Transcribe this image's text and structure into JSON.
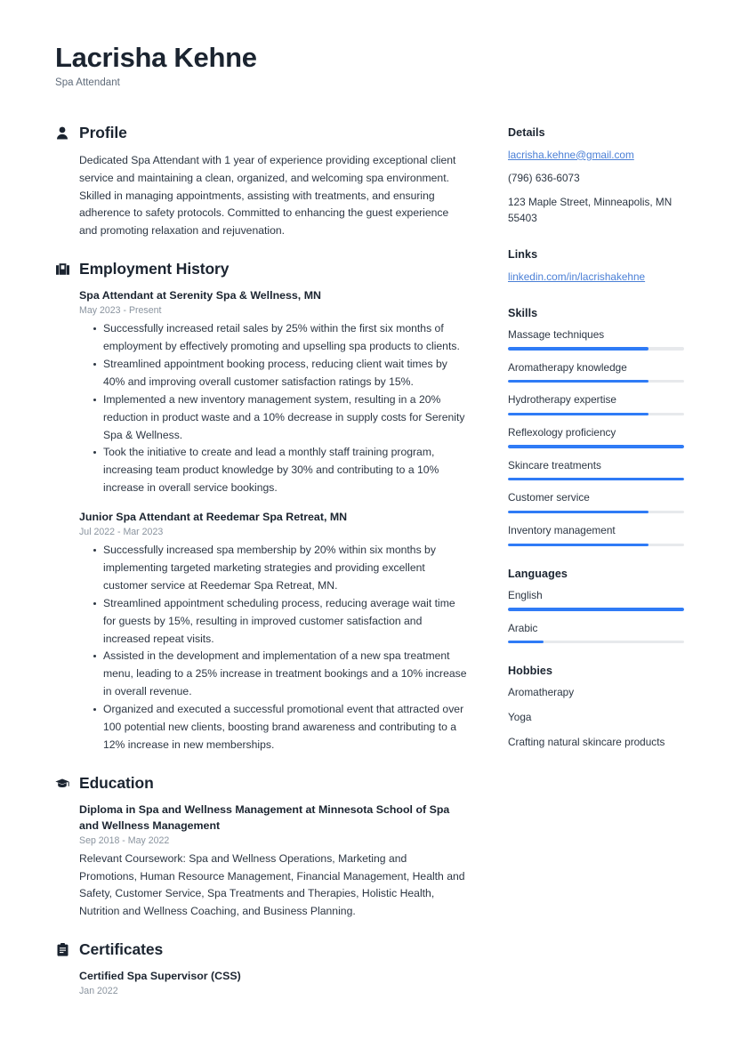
{
  "header": {
    "name": "Lacrisha Kehne",
    "job_title": "Spa Attendant"
  },
  "sections": {
    "profile": {
      "title": "Profile",
      "icon": "person-icon",
      "text": "Dedicated Spa Attendant with 1 year of experience providing exceptional client service and maintaining a clean, organized, and welcoming spa environment. Skilled in managing appointments, assisting with treatments, and ensuring adherence to safety protocols. Committed to enhancing the guest experience and promoting relaxation and rejuvenation."
    },
    "employment": {
      "title": "Employment History",
      "icon": "briefcase-icon",
      "entries": [
        {
          "title": "Spa Attendant at Serenity Spa & Wellness, MN",
          "date": "May 2023 - Present",
          "bullets": [
            "Successfully increased retail sales by 25% within the first six months of employment by effectively promoting and upselling spa products to clients.",
            "Streamlined appointment booking process, reducing client wait times by 40% and improving overall customer satisfaction ratings by 15%.",
            "Implemented a new inventory management system, resulting in a 20% reduction in product waste and a 10% decrease in supply costs for Serenity Spa & Wellness.",
            "Took the initiative to create and lead a monthly staff training program, increasing team product knowledge by 30% and contributing to a 10% increase in overall service bookings."
          ]
        },
        {
          "title": "Junior Spa Attendant at Reedemar Spa Retreat, MN",
          "date": "Jul 2022 - Mar 2023",
          "bullets": [
            "Successfully increased spa membership by 20% within six months by implementing targeted marketing strategies and providing excellent customer service at Reedemar Spa Retreat, MN.",
            "Streamlined appointment scheduling process, reducing average wait time for guests by 15%, resulting in improved customer satisfaction and increased repeat visits.",
            "Assisted in the development and implementation of a new spa treatment menu, leading to a 25% increase in treatment bookings and a 10% increase in overall revenue.",
            "Organized and executed a successful promotional event that attracted over 100 potential new clients, boosting brand awareness and contributing to a 12% increase in new memberships."
          ]
        }
      ]
    },
    "education": {
      "title": "Education",
      "icon": "graduation-cap-icon",
      "entries": [
        {
          "title": "Diploma in Spa and Wellness Management at Minnesota School of Spa and Wellness Management",
          "date": "Sep 2018 - May 2022",
          "description": "Relevant Coursework: Spa and Wellness Operations, Marketing and Promotions, Human Resource Management, Financial Management, Health and Safety, Customer Service, Spa Treatments and Therapies, Holistic Health, Nutrition and Wellness Coaching, and Business Planning."
        }
      ]
    },
    "certificates": {
      "title": "Certificates",
      "icon": "clipboard-icon",
      "entries": [
        {
          "title": "Certified Spa Supervisor (CSS)",
          "date": "Jan 2022"
        }
      ]
    }
  },
  "sidebar": {
    "details": {
      "title": "Details",
      "email": "lacrisha.kehne@gmail.com",
      "phone": "(796) 636-6073",
      "address": "123 Maple Street, Minneapolis, MN 55403"
    },
    "links": {
      "title": "Links",
      "items": [
        {
          "label": "linkedin.com/in/lacrishakehne"
        }
      ]
    },
    "skills": {
      "title": "Skills",
      "items": [
        {
          "label": "Massage techniques",
          "level": 80
        },
        {
          "label": "Aromatherapy knowledge",
          "level": 80
        },
        {
          "label": "Hydrotherapy expertise",
          "level": 80
        },
        {
          "label": "Reflexology proficiency",
          "level": 100
        },
        {
          "label": "Skincare treatments",
          "level": 100
        },
        {
          "label": "Customer service",
          "level": 80
        },
        {
          "label": "Inventory management",
          "level": 80
        }
      ]
    },
    "languages": {
      "title": "Languages",
      "items": [
        {
          "label": "English",
          "level": 100
        },
        {
          "label": "Arabic",
          "level": 20
        }
      ]
    },
    "hobbies": {
      "title": "Hobbies",
      "items": [
        {
          "label": "Aromatherapy"
        },
        {
          "label": "Yoga"
        },
        {
          "label": "Crafting natural skincare products"
        }
      ]
    }
  },
  "theme": {
    "accent": "#2f7bf6",
    "link": "#4a7fd6",
    "heading": "#1b2430",
    "text": "#2c3643",
    "muted": "#8a949f",
    "track": "#e7e9ec"
  }
}
